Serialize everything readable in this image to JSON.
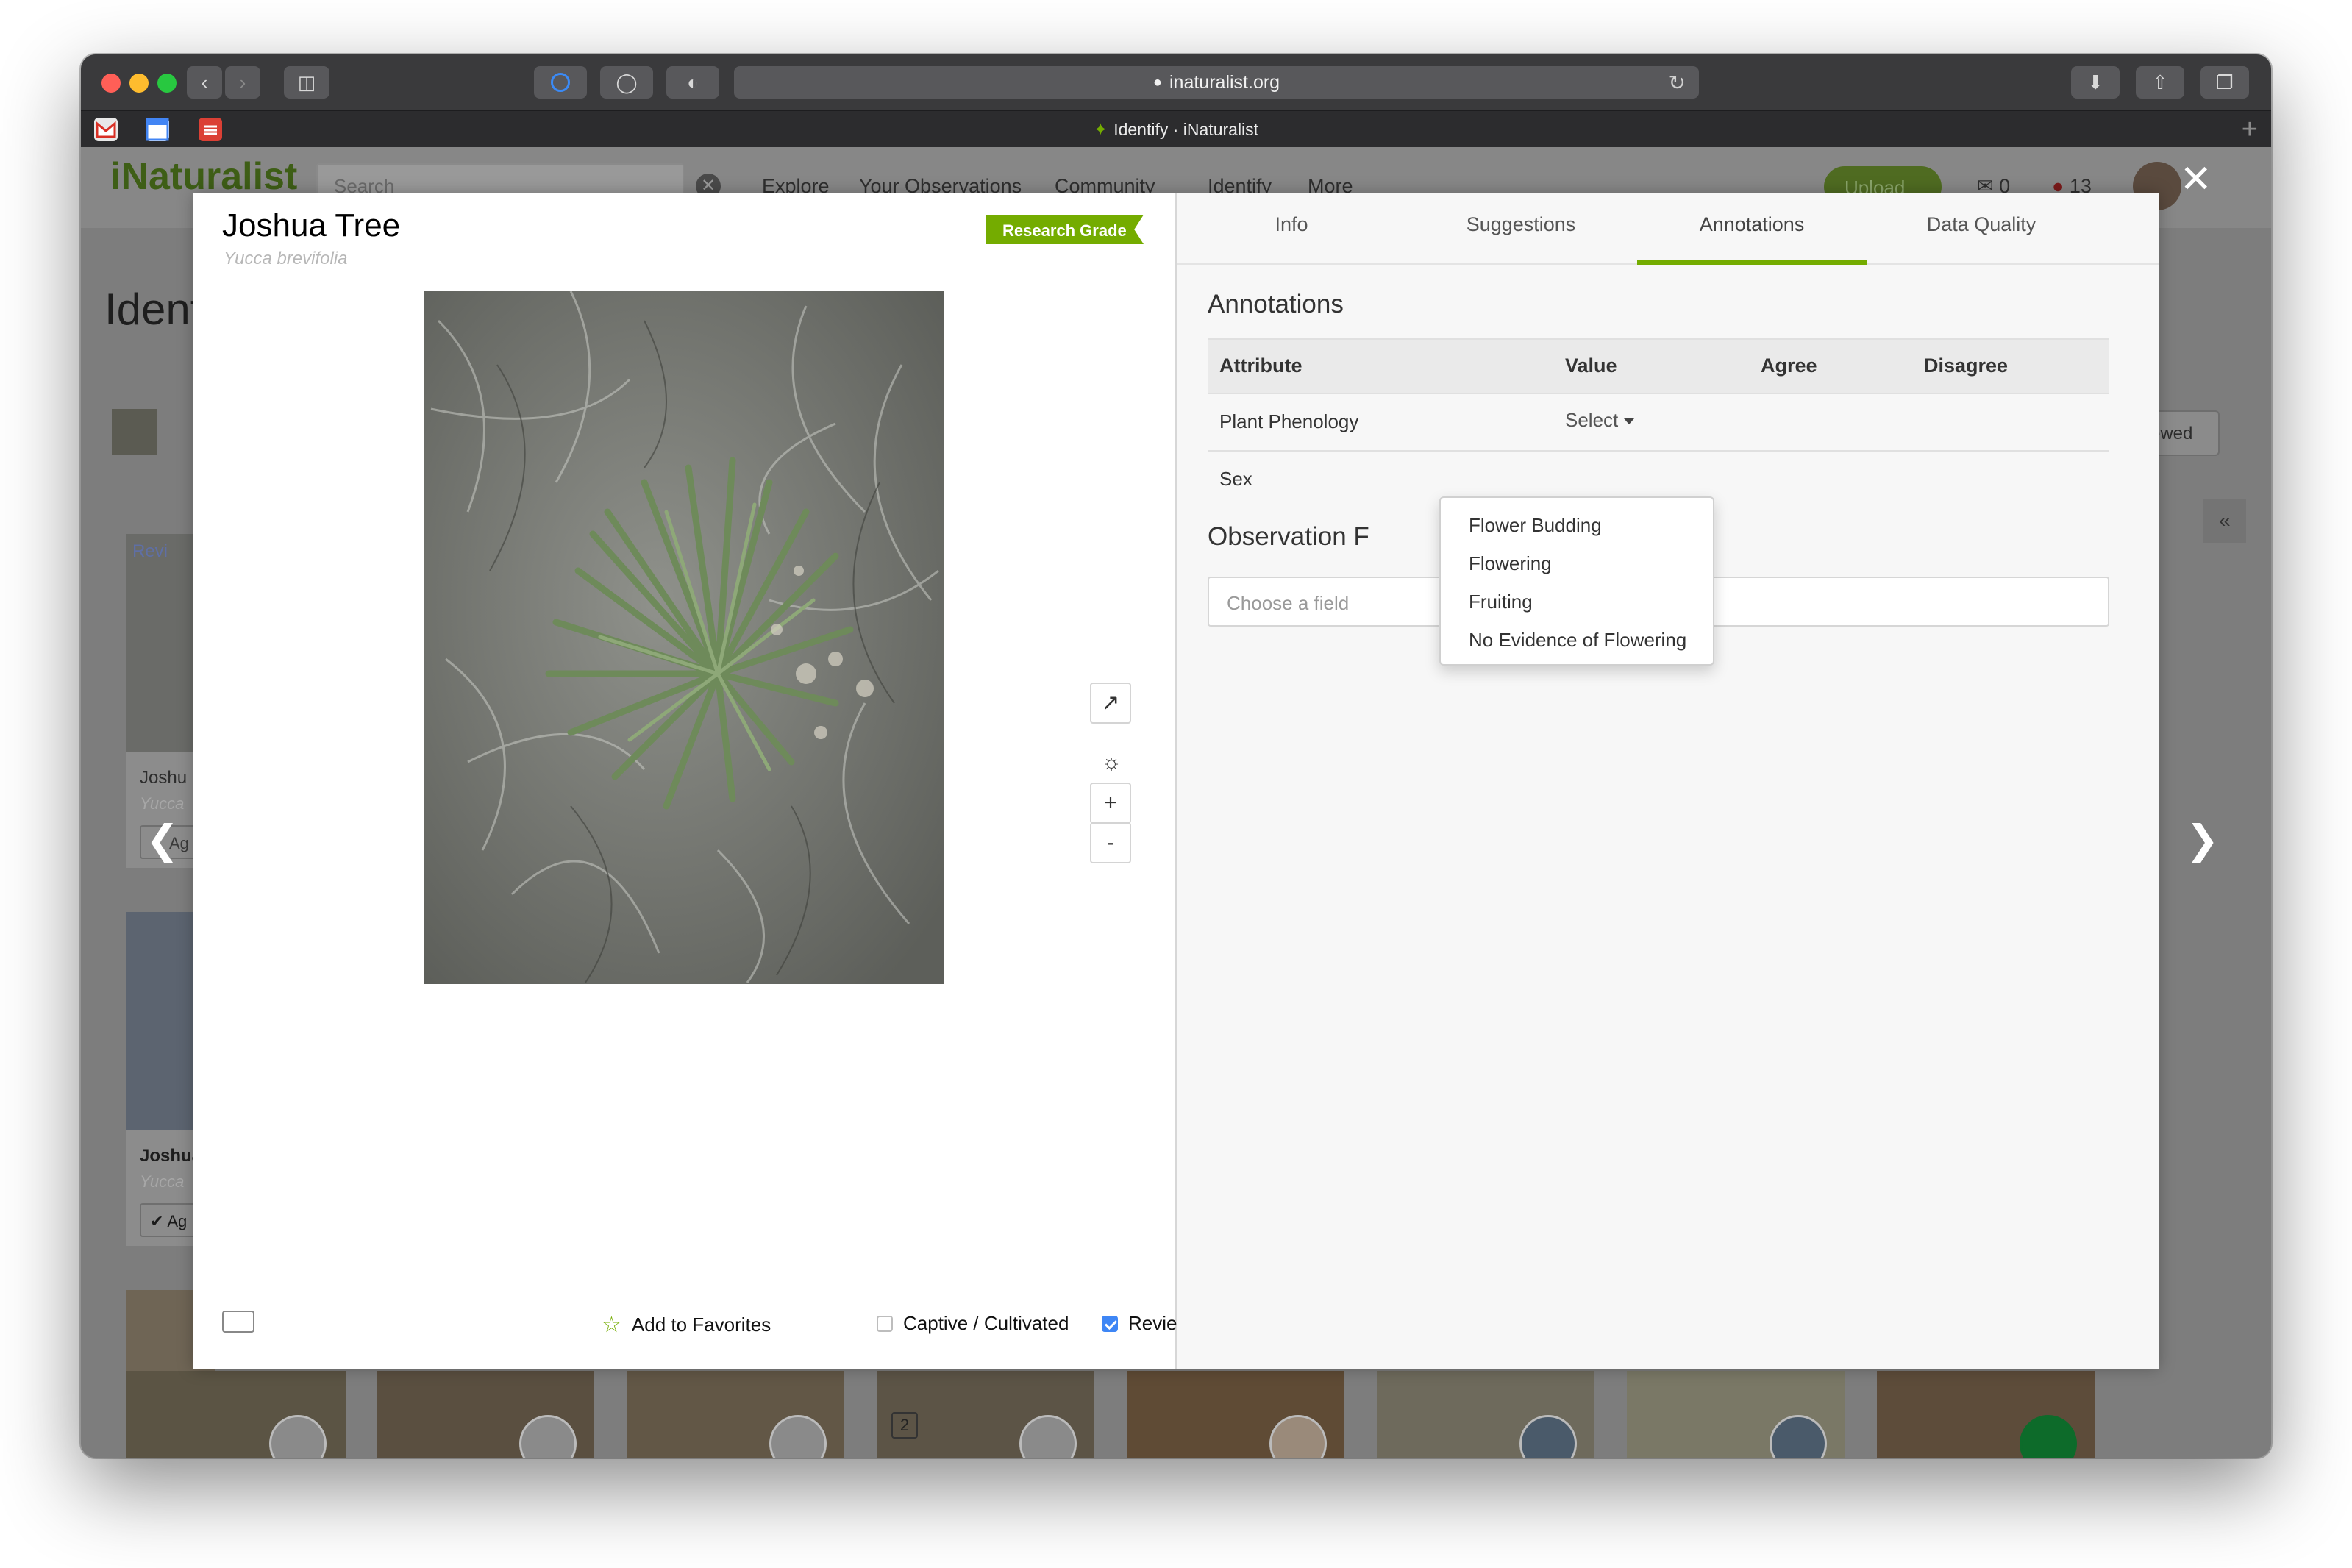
{
  "browser": {
    "url": "inaturalist.org",
    "tab_title": "Identify · iNaturalist",
    "favicons": [
      "gmail-icon",
      "calendar-icon",
      "todoist-icon"
    ]
  },
  "site": {
    "logo": "iNaturalist",
    "search_placeholder": "Search",
    "nav": [
      "Explore",
      "Your Observations",
      "Community",
      "Identify",
      "More"
    ],
    "upload_label": "Upload",
    "messages_count": "0",
    "notifications_count": "13",
    "page_title": "Ident",
    "reviewed_btn": "ewed"
  },
  "background_cards": [
    {
      "title": "Joshu",
      "subtitle": "Yucca",
      "badge": "Revi",
      "agree": "Ag"
    },
    {
      "title": "Joshua",
      "subtitle": "Yucca",
      "agree": "Ag"
    }
  ],
  "modal": {
    "title": "Joshua Tree",
    "scientific_name": "Yucca brevifolia",
    "quality_badge": "Research Grade",
    "controls": {
      "zoom_in": "+",
      "zoom_out": "-"
    },
    "footer": {
      "favorites": "Add to Favorites",
      "captive": "Captive / Cultivated",
      "reviewed": "Reviewed",
      "reviewed_checked": true,
      "captive_checked": false
    },
    "tabs": [
      "Info",
      "Suggestions",
      "Annotations",
      "Data Quality"
    ],
    "active_tab": "Annotations",
    "annotations": {
      "heading": "Annotations",
      "columns": [
        "Attribute",
        "Value",
        "Agree",
        "Disagree"
      ],
      "rows": [
        {
          "attribute": "Plant Phenology",
          "value": "Select"
        },
        {
          "attribute": "Sex",
          "value": ""
        }
      ]
    },
    "observation_fields": {
      "heading": "Observation F",
      "placeholder": "Choose a field"
    },
    "dropdown_options": [
      "Flower Budding",
      "Flowering",
      "Fruiting",
      "No Evidence of Flowering"
    ]
  },
  "colors": {
    "brand_green": "#74ac00",
    "checkbox_blue": "#3e86f5"
  },
  "thumbnail_counter": "2"
}
